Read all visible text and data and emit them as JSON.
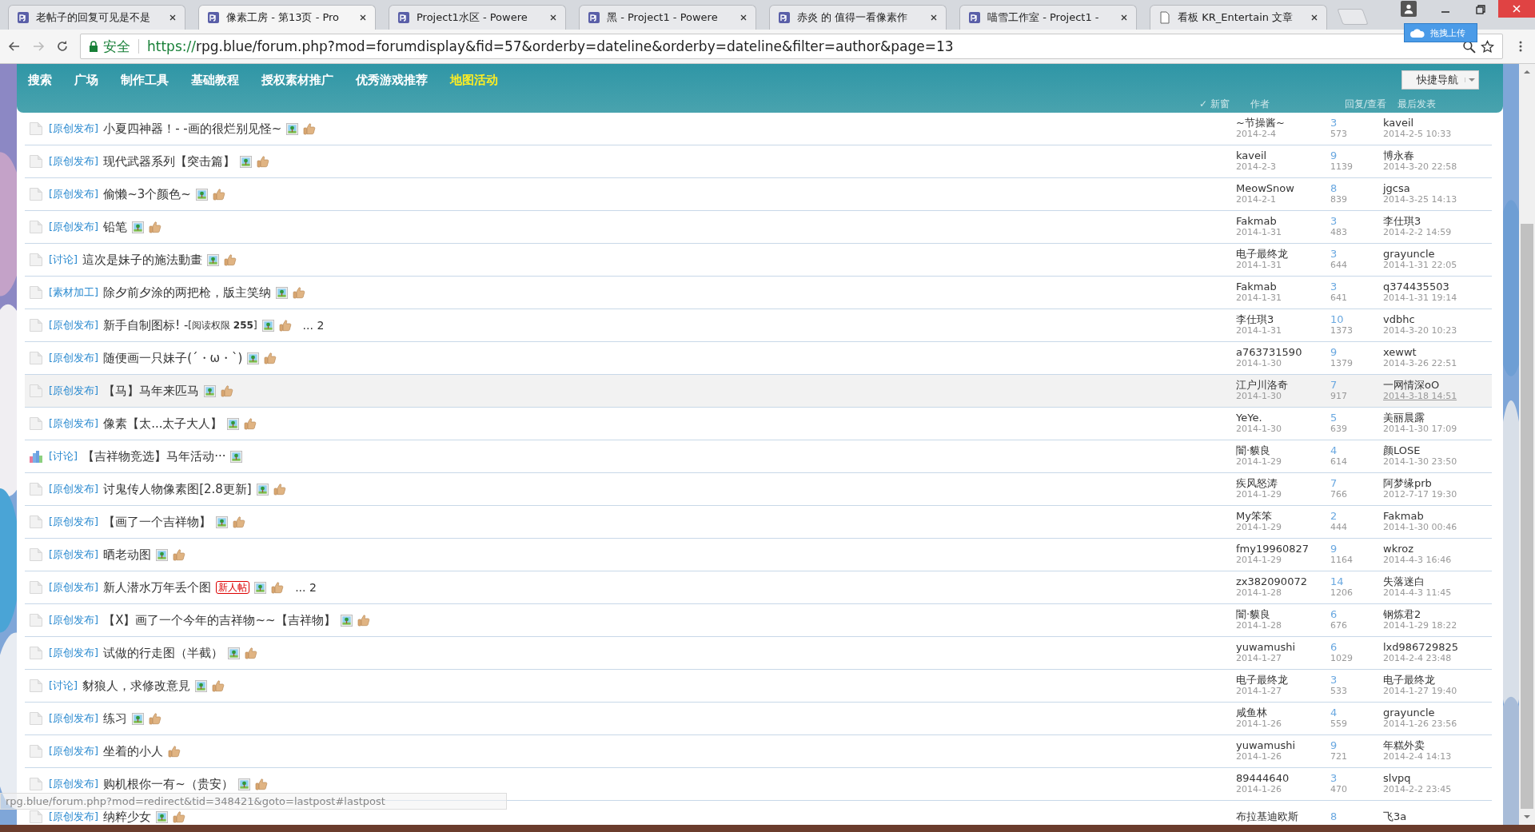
{
  "browser": {
    "tabs": [
      {
        "title": "老帖子的回复可见是不是",
        "kind": "site",
        "selected": false
      },
      {
        "title": "像素工房 - 第13页 - Pro",
        "kind": "site",
        "selected": true
      },
      {
        "title": "Project1水区 - Powere",
        "kind": "site",
        "selected": false
      },
      {
        "title": "黑 - Project1 - Powere",
        "kind": "site",
        "selected": false
      },
      {
        "title": "赤炎 的 值得一看像素作",
        "kind": "site",
        "selected": false
      },
      {
        "title": "喵雪工作室 - Project1 -",
        "kind": "site",
        "selected": false
      },
      {
        "title": "看板 KR_Entertain 文章",
        "kind": "doc",
        "selected": false
      }
    ],
    "upload_button": "拖拽上传",
    "security_label": "安全",
    "url_scheme": "https://",
    "url_rest": "rpg.blue/forum.php?mod=forumdisplay&fid=57&orderby=dateline&orderby=dateline&filter=author&page=13"
  },
  "nav": {
    "items": [
      {
        "label": "搜索",
        "selected": false
      },
      {
        "label": "广场",
        "selected": false
      },
      {
        "label": "制作工具",
        "selected": false
      },
      {
        "label": "基础教程",
        "selected": false
      },
      {
        "label": "授权素材推广",
        "selected": false
      },
      {
        "label": "优秀游戏推荐",
        "selected": false
      },
      {
        "label": "地图活动",
        "selected": true
      }
    ],
    "quick_nav": "快捷导航",
    "new_window_check": "✓",
    "new_window": "新窗",
    "headers": [
      "作者",
      "回复/查看",
      "最后发表"
    ]
  },
  "threads": [
    {
      "kind": "file",
      "tag": "[原创发布]",
      "title": "小夏四神器！- -画的很烂别见怪~",
      "image": true,
      "thumb": true,
      "author": "~节操酱~",
      "date": "2014-2-4",
      "replies": "3",
      "views": "573",
      "last_user": "kaveil",
      "last_time": "2014-2-5 10:33",
      "hovered": false
    },
    {
      "kind": "file",
      "tag": "[原创发布]",
      "title": "现代武器系列【突击篇】",
      "image": true,
      "thumb": true,
      "author": "kaveil",
      "date": "2014-2-3",
      "replies": "9",
      "views": "1139",
      "last_user": "博永春",
      "last_time": "2014-3-20 22:58",
      "hovered": false
    },
    {
      "kind": "file",
      "tag": "[原创发布]",
      "title": "偷懒~3个颜色~",
      "image": true,
      "thumb": true,
      "author": "MeowSnow",
      "date": "2014-2-1",
      "replies": "8",
      "views": "839",
      "last_user": "jgcsa",
      "last_time": "2014-3-25 14:13",
      "hovered": false
    },
    {
      "kind": "file",
      "tag": "[原创发布]",
      "title": "铅笔",
      "image": true,
      "thumb": true,
      "author": "Fakmab",
      "date": "2014-1-31",
      "replies": "3",
      "views": "483",
      "last_user": "李仕琪3",
      "last_time": "2014-2-2 14:59",
      "hovered": false
    },
    {
      "kind": "file",
      "tag": "[讨论]",
      "title": "這次是妹子的施法動畫",
      "image": true,
      "thumb": true,
      "author": "电子最终龙",
      "date": "2014-1-31",
      "replies": "3",
      "views": "644",
      "last_user": "grayuncle",
      "last_time": "2014-1-31 22:05",
      "hovered": false
    },
    {
      "kind": "file",
      "tag": "[素材加工]",
      "title": "除夕前夕涂的两把枪，版主笑纳",
      "image": true,
      "thumb": true,
      "author": "Fakmab",
      "date": "2014-1-31",
      "replies": "3",
      "views": "641",
      "last_user": "q374435503",
      "last_time": "2014-1-31 19:14",
      "hovered": false
    },
    {
      "kind": "file",
      "tag": "[原创发布]",
      "title": "新手自制图标! -",
      "read_permission": "[阅读权限 **255**]",
      "image": true,
      "thumb": true,
      "pages": "... 2",
      "author": "李仕琪3",
      "date": "2014-1-31",
      "replies": "10",
      "views": "1373",
      "last_user": "vdbhc",
      "last_time": "2014-3-20 10:23",
      "hovered": false
    },
    {
      "kind": "file",
      "tag": "[原创发布]",
      "title": "随便画一只妹子(´・ω・`)",
      "image": true,
      "thumb": true,
      "author": "a763731590",
      "date": "2014-1-30",
      "replies": "9",
      "views": "1379",
      "last_user": "xewwt",
      "last_time": "2014-3-26 22:51",
      "hovered": false
    },
    {
      "kind": "file",
      "tag": "[原创发布]",
      "title": "【马】马年来匹马",
      "image": true,
      "thumb": true,
      "author": "江户川洛奇",
      "date": "2014-1-30",
      "replies": "7",
      "views": "917",
      "last_user": "一网情深oO",
      "last_time": "2014-3-18 14:51",
      "hovered": true
    },
    {
      "kind": "file",
      "tag": "[原创发布]",
      "title": "像素【太...太子大人】",
      "image": true,
      "thumb": true,
      "author": "YeYe.",
      "date": "2014-1-30",
      "replies": "5",
      "views": "639",
      "last_user": "美丽晨露",
      "last_time": "2014-1-30 17:09",
      "hovered": false
    },
    {
      "kind": "poll",
      "tag": "[讨论]",
      "title": "【吉祥物竞选】马年活动···",
      "image": true,
      "thumb": false,
      "author": "闇·貘良",
      "date": "2014-1-29",
      "replies": "4",
      "views": "614",
      "last_user": "颜LOSE",
      "last_time": "2014-1-30 23:50",
      "hovered": false
    },
    {
      "kind": "file",
      "tag": "[原创发布]",
      "title": "讨鬼传人物像素图[2.8更新]",
      "image": true,
      "thumb": true,
      "author": "疾风怒涛",
      "date": "2014-1-29",
      "replies": "7",
      "views": "766",
      "last_user": "阿梦缘prb",
      "last_time": "2012-7-17 19:30",
      "hovered": false
    },
    {
      "kind": "file",
      "tag": "[原创发布]",
      "title": "【画了一个吉祥物】",
      "image": true,
      "thumb": true,
      "author": "My笨笨",
      "date": "2014-1-29",
      "replies": "2",
      "views": "444",
      "last_user": "Fakmab",
      "last_time": "2014-1-30 00:46",
      "hovered": false
    },
    {
      "kind": "file",
      "tag": "[原创发布]",
      "title": "晒老动图",
      "image": true,
      "thumb": true,
      "author": "fmy19960827",
      "date": "2014-1-29",
      "replies": "9",
      "views": "1164",
      "last_user": "wkroz",
      "last_time": "2014-4-3 16:46",
      "hovered": false
    },
    {
      "kind": "file",
      "tag": "[原创发布]",
      "title": "新人潜水万年丢个图",
      "badge": "新人帖",
      "image": true,
      "thumb": true,
      "pages": "... 2",
      "author": "zx382090072",
      "date": "2014-1-28",
      "replies": "14",
      "views": "1206",
      "last_user": "失落迷白",
      "last_time": "2014-4-3 11:45",
      "hovered": false
    },
    {
      "kind": "file",
      "tag": "[原创发布]",
      "title": "【X】画了一个今年的吉祥物~~【吉祥物】",
      "image": true,
      "thumb": true,
      "author": "闇·貘良",
      "date": "2014-1-28",
      "replies": "6",
      "views": "676",
      "last_user": "钢炼君2",
      "last_time": "2014-1-29 18:22",
      "hovered": false
    },
    {
      "kind": "file",
      "tag": "[原创发布]",
      "title": "试做的行走图（半截）",
      "image": true,
      "thumb": true,
      "author": "yuwamushi",
      "date": "2014-1-27",
      "replies": "6",
      "views": "1029",
      "last_user": "lxd986729825",
      "last_time": "2014-2-4 23:48",
      "hovered": false
    },
    {
      "kind": "file",
      "tag": "[讨论]",
      "title": "豺狼人，求修改意見",
      "image": true,
      "thumb": true,
      "author": "电子最终龙",
      "date": "2014-1-27",
      "replies": "3",
      "views": "533",
      "last_user": "电子最终龙",
      "last_time": "2014-1-27 19:40",
      "hovered": false
    },
    {
      "kind": "file",
      "tag": "[原创发布]",
      "title": "练习",
      "image": true,
      "thumb": true,
      "author": "咸鱼林",
      "date": "2014-1-26",
      "replies": "4",
      "views": "559",
      "last_user": "grayuncle",
      "last_time": "2014-1-26 23:56",
      "hovered": false
    },
    {
      "kind": "file",
      "tag": "[原创发布]",
      "title": "坐着的小人",
      "image": false,
      "thumb": true,
      "author": "yuwamushi",
      "date": "2014-1-26",
      "replies": "9",
      "views": "721",
      "last_user": "年糕外卖",
      "last_time": "2014-2-4 14:13",
      "hovered": false
    },
    {
      "kind": "file",
      "tag": "[原创发布]",
      "title": "购机根你一有~（贵安）",
      "image": true,
      "thumb": true,
      "author": "89444640",
      "date": "2014-1-26",
      "replies": "3",
      "views": "470",
      "last_user": "slvpq",
      "last_time": "2014-2-2 23:45",
      "hovered": false
    },
    {
      "kind": "file",
      "tag": "[原创发布]",
      "title": "纳粹少女",
      "image": true,
      "thumb": true,
      "author": "布拉基迪欧斯",
      "replies": "8",
      "last_user": "飞3a",
      "hovered": false
    }
  ],
  "status_url": "rpg.blue/forum.php?mod=redirect&tid=348421&goto=lastpost#lastpost"
}
